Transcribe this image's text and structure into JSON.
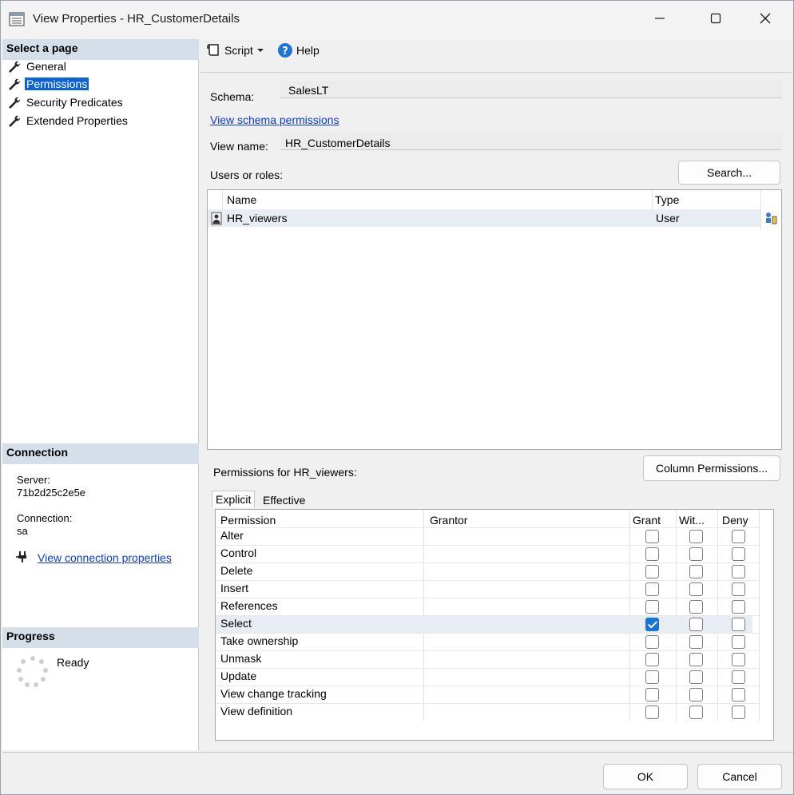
{
  "window": {
    "title": "View Properties - HR_CustomerDetails"
  },
  "sidebar": {
    "header": "Select a page",
    "items": [
      {
        "label": "General"
      },
      {
        "label": "Permissions"
      },
      {
        "label": "Security Predicates"
      },
      {
        "label": "Extended Properties"
      }
    ]
  },
  "connection": {
    "header": "Connection",
    "server_label": "Server:",
    "server_value": "71b2d25c2e5e",
    "connection_label": "Connection:",
    "connection_value": "sa",
    "link_label": "View connection properties"
  },
  "progress": {
    "header": "Progress",
    "status": "Ready"
  },
  "toolbar": {
    "script_label": "Script",
    "help_label": "Help"
  },
  "form": {
    "schema_label": "Schema:",
    "schema_value": "SalesLT",
    "schema_link": "View schema permissions",
    "view_name_label": "View name:",
    "view_name_value": "HR_CustomerDetails",
    "users_label": "Users or roles:",
    "search_button": "Search..."
  },
  "users_table": {
    "columns": [
      "Name",
      "Type"
    ],
    "rows": [
      {
        "name": "HR_viewers",
        "type": "User"
      }
    ]
  },
  "permissions": {
    "label": "Permissions for HR_viewers:",
    "column_permissions_button": "Column Permissions...",
    "tabs": [
      "Explicit",
      "Effective"
    ],
    "columns": [
      "Permission",
      "Grantor",
      "Grant",
      "Wit...",
      "Deny"
    ],
    "rows": [
      {
        "name": "Alter",
        "grantor": "",
        "grant": false,
        "with_grant": false,
        "deny": false
      },
      {
        "name": "Control",
        "grantor": "",
        "grant": false,
        "with_grant": false,
        "deny": false
      },
      {
        "name": "Delete",
        "grantor": "",
        "grant": false,
        "with_grant": false,
        "deny": false
      },
      {
        "name": "Insert",
        "grantor": "",
        "grant": false,
        "with_grant": false,
        "deny": false
      },
      {
        "name": "References",
        "grantor": "",
        "grant": false,
        "with_grant": false,
        "deny": false
      },
      {
        "name": "Select",
        "grantor": "",
        "grant": true,
        "with_grant": false,
        "deny": false
      },
      {
        "name": "Take ownership",
        "grantor": "",
        "grant": false,
        "with_grant": false,
        "deny": false
      },
      {
        "name": "Unmask",
        "grantor": "",
        "grant": false,
        "with_grant": false,
        "deny": false
      },
      {
        "name": "Update",
        "grantor": "",
        "grant": false,
        "with_grant": false,
        "deny": false
      },
      {
        "name": "View change tracking",
        "grantor": "",
        "grant": false,
        "with_grant": false,
        "deny": false
      },
      {
        "name": "View definition",
        "grantor": "",
        "grant": false,
        "with_grant": false,
        "deny": false
      }
    ]
  },
  "footer": {
    "ok_label": "OK",
    "cancel_label": "Cancel"
  },
  "colors": {
    "accent": "#0a64d8",
    "section_header": "#d4dfea",
    "checked": "#1a73d9"
  }
}
